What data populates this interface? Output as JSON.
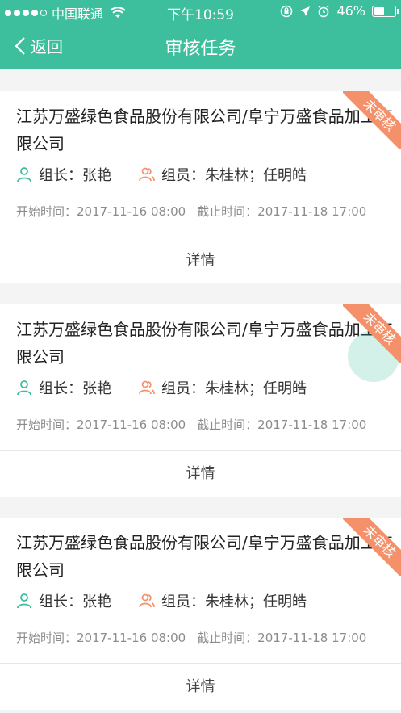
{
  "status_bar": {
    "carrier": "中国联通",
    "time": "下午10:59",
    "battery": "46%"
  },
  "nav": {
    "back_label": "返回",
    "title": "审核任务"
  },
  "tasks": [
    {
      "company": "江苏万盛绿色食品股份有限公司/阜宁万盛食品加工有限公司",
      "leader": "组长：张艳",
      "members": "组员：朱桂林；任明皓",
      "start": "开始时间：2017-11-16 08:00",
      "end": "截止时间：2017-11-18 17:00",
      "status": "未审核",
      "detail": "详情"
    },
    {
      "company": "江苏万盛绿色食品股份有限公司/阜宁万盛食品加工有限公司",
      "leader": "组长：张艳",
      "members": "组员：朱桂林；任明皓",
      "start": "开始时间：2017-11-16 08:00",
      "end": "截止时间：2017-11-18 17:00",
      "status": "未审核",
      "detail": "详情"
    },
    {
      "company": "江苏万盛绿色食品股份有限公司/阜宁万盛食品加工有限公司",
      "leader": "组长：张艳",
      "members": "组员：朱桂林；任明皓",
      "start": "开始时间：2017-11-16 08:00",
      "end": "截止时间：2017-11-18 17:00",
      "status": "未审核",
      "detail": "详情"
    }
  ],
  "colors": {
    "brand": "#3dbf9d",
    "ribbon": "#f4916b",
    "leader_icon": "#3dbf9d",
    "member_icon": "#f4916b"
  }
}
